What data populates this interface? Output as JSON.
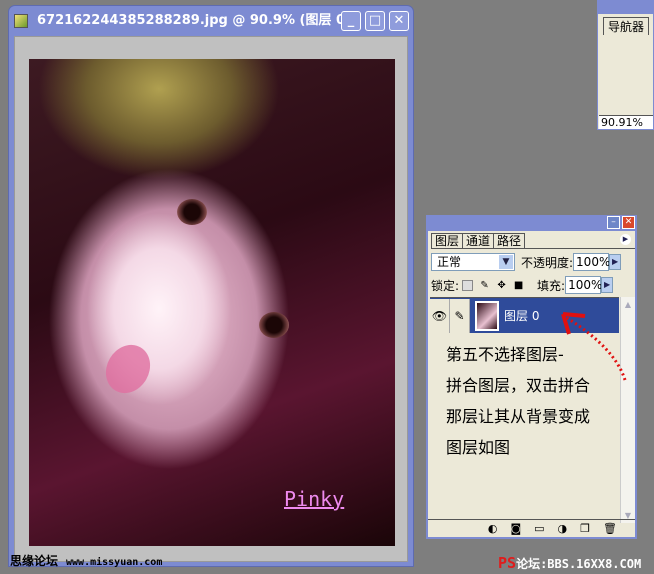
{
  "document": {
    "title": "672162244385288289.jpg @ 90.9% (图层 0,...",
    "minimize": "_",
    "maximize": "□",
    "close": "✕"
  },
  "photo": {
    "signature": "Pinky"
  },
  "watermarks": {
    "left_cn": "思缘论坛",
    "left_url": "www.missyuan.com",
    "ps": "PS",
    "ps_rest": "论坛:BBS.16XX8.COM"
  },
  "navigator": {
    "tab": "导航器",
    "zoom": "90.91%"
  },
  "layers_panel": {
    "tabs": [
      "图层",
      "通道",
      "路径"
    ],
    "blend_mode": "正常",
    "opacity_label": "不透明度:",
    "opacity": "100%",
    "lock_label": "锁定:",
    "fill_label": "填充:",
    "fill": "100%",
    "layer_name": "图层 0",
    "note": [
      "第五不选择图层-",
      "拼合图层，双击拼合",
      "那层让其从背景变成",
      "图层如图"
    ],
    "bottom_icons": [
      "link-icon",
      "layer-style-icon",
      "mask-icon",
      "folder-icon",
      "adjustment-icon",
      "new-layer-icon",
      "trash-icon"
    ]
  }
}
